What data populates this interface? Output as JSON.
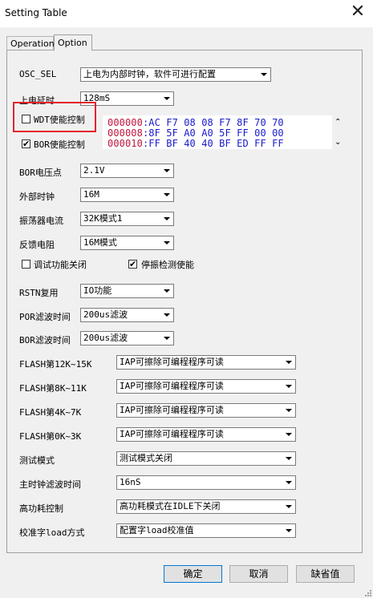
{
  "window": {
    "title": "Setting Table",
    "close_glyph": "✕"
  },
  "tabs": [
    {
      "label": "Operation"
    },
    {
      "label": "Option"
    }
  ],
  "osc_sel": {
    "label": "OSC_SEL",
    "value": "上电为内部时钟，软件可进行配置"
  },
  "power_delay": {
    "label": "上电延时",
    "value": "128mS"
  },
  "wdt": {
    "label": "WDT使能控制",
    "checked": false
  },
  "bor_enable": {
    "label": "BOR使能控制",
    "checked": true,
    "check_glyph": "✔"
  },
  "hex_view": {
    "lines": [
      {
        "addr": "000000",
        "sep": ":",
        "bytes": "AC F7 08 08 F7 8F 70 70"
      },
      {
        "addr": "000008",
        "sep": ":",
        "bytes": "8F 5F A0 A0 5F FF 00 00"
      },
      {
        "addr": "000010",
        "sep": ":",
        "bytes": "FF BF 40 40 BF ED FF FF"
      }
    ],
    "scroll_up_glyph": "⌃",
    "scroll_down_glyph": "⌄"
  },
  "bor_voltage": {
    "label": "BOR电压点",
    "value": "2.1V"
  },
  "ext_clock": {
    "label": "外部时钟",
    "value": "16M"
  },
  "osc_current": {
    "label": "振荡器电流",
    "value": "32K模式1"
  },
  "feedback_res": {
    "label": "反馈电阻",
    "value": "16M模式"
  },
  "debug_off": {
    "label": "调试功能关闭",
    "checked": false
  },
  "stop_detect": {
    "label": "停振检测使能",
    "checked": true,
    "check_glyph": "✔"
  },
  "rstn": {
    "label": "RSTN复用",
    "value": "IO功能"
  },
  "por_filter": {
    "label": "POR滤波时间",
    "value": "200us滤波"
  },
  "bor_filter": {
    "label": "BOR滤波时间",
    "value": "200us滤波"
  },
  "flash_12k": {
    "label": "FLASH第12K~15K",
    "value": "IAP可擦除可编程程序可读"
  },
  "flash_8k": {
    "label": "FLASH第8K~11K",
    "value": "IAP可擦除可编程程序可读"
  },
  "flash_4k": {
    "label": "FLASH第4K~7K",
    "value": "IAP可擦除可编程程序可读"
  },
  "flash_0k": {
    "label": "FLASH第0K~3K",
    "value": "IAP可擦除可编程程序可读"
  },
  "test_mode": {
    "label": "测试模式",
    "value": "测试模式关闭"
  },
  "main_clk_filter": {
    "label": "主时钟滤波时间",
    "value": "16nS"
  },
  "high_power": {
    "label": "高功耗控制",
    "value": "高功耗模式在IDLE下关闭"
  },
  "cal_load": {
    "label": "校准字load方式",
    "value": "配置字load校准值"
  },
  "buttons": {
    "ok": "确定",
    "cancel": "取消",
    "default": "缺省值"
  },
  "colors": {
    "highlight": "#e3232c",
    "hex_addr": "#c0143c",
    "hex_bytes": "#1a1acc"
  }
}
